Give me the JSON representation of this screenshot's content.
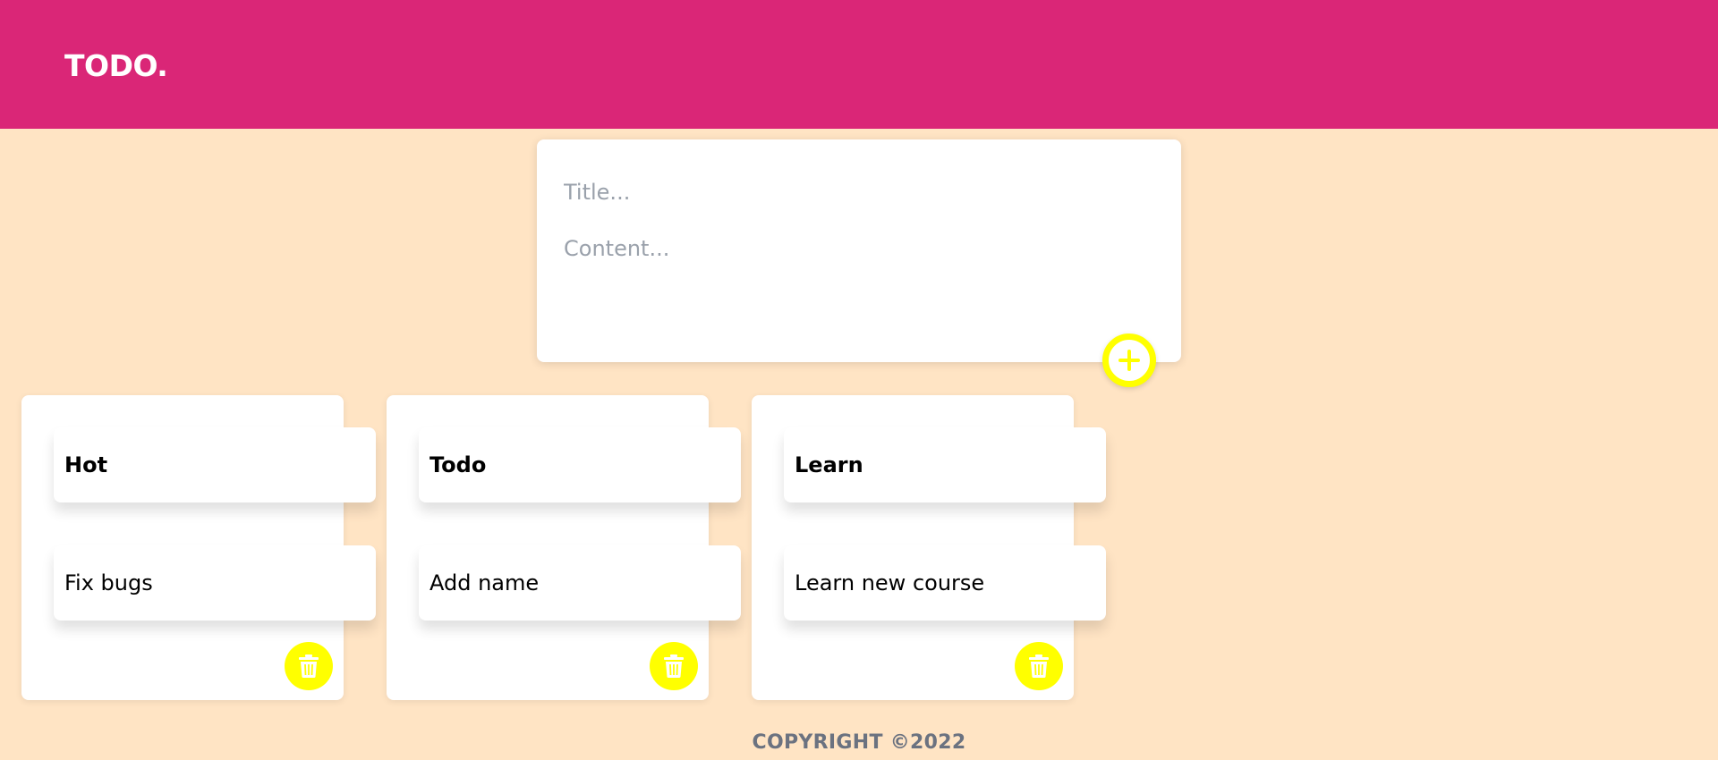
{
  "header": {
    "logo": "TODO.",
    "background_color": "#da2677"
  },
  "composer": {
    "title_placeholder": "Title...",
    "content_placeholder": "Content...",
    "add_icon": "plus-circle-icon",
    "accent_color": "#ffff00"
  },
  "notes": [
    {
      "title": "Hot",
      "content": "Fix bugs",
      "delete_icon": "trash-icon"
    },
    {
      "title": "Todo",
      "content": "Add name",
      "delete_icon": "trash-icon"
    },
    {
      "title": "Learn",
      "content": "Learn new course",
      "delete_icon": "trash-icon"
    }
  ],
  "footer": {
    "copyright": "COPYRIGHT ©2022"
  },
  "colors": {
    "page_background": "#ffe4c4",
    "accent": "#ffff00",
    "brand": "#da2677"
  }
}
